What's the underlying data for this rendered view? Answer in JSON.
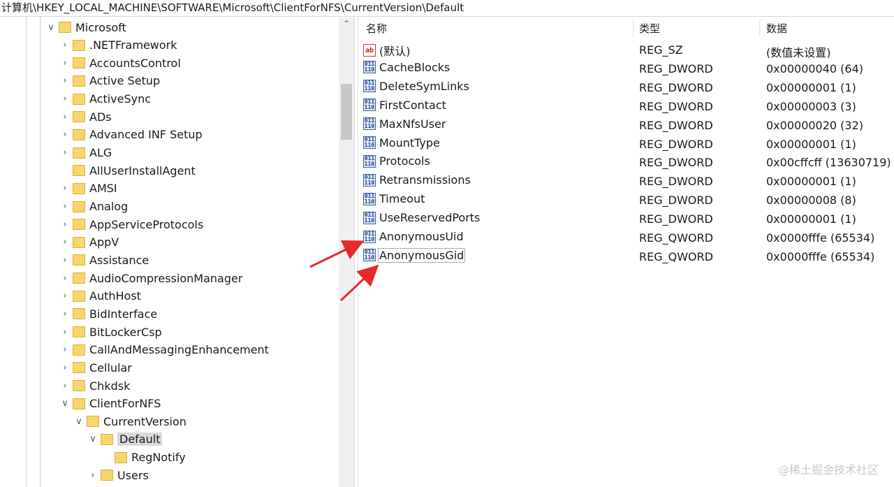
{
  "address": "计算机\\HKEY_LOCAL_MACHINE\\SOFTWARE\\Microsoft\\ClientForNFS\\CurrentVersion\\Default",
  "tree": [
    {
      "label": "Microsoft",
      "level": 0,
      "expander": "open"
    },
    {
      "label": ".NETFramework",
      "level": 1,
      "expander": "closed"
    },
    {
      "label": "AccountsControl",
      "level": 1,
      "expander": "closed"
    },
    {
      "label": "Active Setup",
      "level": 1,
      "expander": "closed"
    },
    {
      "label": "ActiveSync",
      "level": 1,
      "expander": "closed"
    },
    {
      "label": "ADs",
      "level": 1,
      "expander": "closed"
    },
    {
      "label": "Advanced INF Setup",
      "level": 1,
      "expander": "closed"
    },
    {
      "label": "ALG",
      "level": 1,
      "expander": "closed"
    },
    {
      "label": "AllUserInstallAgent",
      "level": 1,
      "expander": "none"
    },
    {
      "label": "AMSI",
      "level": 1,
      "expander": "closed"
    },
    {
      "label": "Analog",
      "level": 1,
      "expander": "closed"
    },
    {
      "label": "AppServiceProtocols",
      "level": 1,
      "expander": "closed"
    },
    {
      "label": "AppV",
      "level": 1,
      "expander": "closed"
    },
    {
      "label": "Assistance",
      "level": 1,
      "expander": "closed"
    },
    {
      "label": "AudioCompressionManager",
      "level": 1,
      "expander": "closed"
    },
    {
      "label": "AuthHost",
      "level": 1,
      "expander": "closed"
    },
    {
      "label": "BidInterface",
      "level": 1,
      "expander": "closed"
    },
    {
      "label": "BitLockerCsp",
      "level": 1,
      "expander": "closed"
    },
    {
      "label": "CallAndMessagingEnhancement",
      "level": 1,
      "expander": "closed"
    },
    {
      "label": "Cellular",
      "level": 1,
      "expander": "closed"
    },
    {
      "label": "Chkdsk",
      "level": 1,
      "expander": "closed"
    },
    {
      "label": "ClientForNFS",
      "level": 1,
      "expander": "open"
    },
    {
      "label": "CurrentVersion",
      "level": 2,
      "expander": "open"
    },
    {
      "label": "Default",
      "level": 3,
      "expander": "open",
      "selected": true
    },
    {
      "label": "RegNotify",
      "level": 4,
      "expander": "none"
    },
    {
      "label": "Users",
      "level": 3,
      "expander": "closed"
    }
  ],
  "columns": {
    "name": "名称",
    "type": "类型",
    "data": "数据"
  },
  "values": [
    {
      "icon": "string-value-icon",
      "name": "(默认)",
      "type": "REG_SZ",
      "data": "(数值未设置)"
    },
    {
      "icon": "binary-value-icon",
      "name": "CacheBlocks",
      "type": "REG_DWORD",
      "data": "0x00000040 (64)"
    },
    {
      "icon": "binary-value-icon",
      "name": "DeleteSymLinks",
      "type": "REG_DWORD",
      "data": "0x00000001 (1)"
    },
    {
      "icon": "binary-value-icon",
      "name": "FirstContact",
      "type": "REG_DWORD",
      "data": "0x00000003 (3)"
    },
    {
      "icon": "binary-value-icon",
      "name": "MaxNfsUser",
      "type": "REG_DWORD",
      "data": "0x00000020 (32)"
    },
    {
      "icon": "binary-value-icon",
      "name": "MountType",
      "type": "REG_DWORD",
      "data": "0x00000001 (1)"
    },
    {
      "icon": "binary-value-icon",
      "name": "Protocols",
      "type": "REG_DWORD",
      "data": "0x00cffcff (13630719)"
    },
    {
      "icon": "binary-value-icon",
      "name": "Retransmissions",
      "type": "REG_DWORD",
      "data": "0x00000001 (1)"
    },
    {
      "icon": "binary-value-icon",
      "name": "Timeout",
      "type": "REG_DWORD",
      "data": "0x00000008 (8)"
    },
    {
      "icon": "binary-value-icon",
      "name": "UseReservedPorts",
      "type": "REG_DWORD",
      "data": "0x00000001 (1)"
    },
    {
      "icon": "binary-value-icon",
      "name": "AnonymousUid",
      "type": "REG_QWORD",
      "data": "0x0000fffe (65534)"
    },
    {
      "icon": "binary-value-icon",
      "name": "AnonymousGid",
      "type": "REG_QWORD",
      "data": "0x0000fffe (65534)",
      "focused": true
    }
  ],
  "icons": {
    "string": "ab",
    "binary": "011\n110"
  },
  "colors": {
    "arrow": "#e52a2a",
    "folder": "#f8d66c",
    "selection": "#d9d9d9"
  },
  "watermark": "@稀土掘金技术社区"
}
